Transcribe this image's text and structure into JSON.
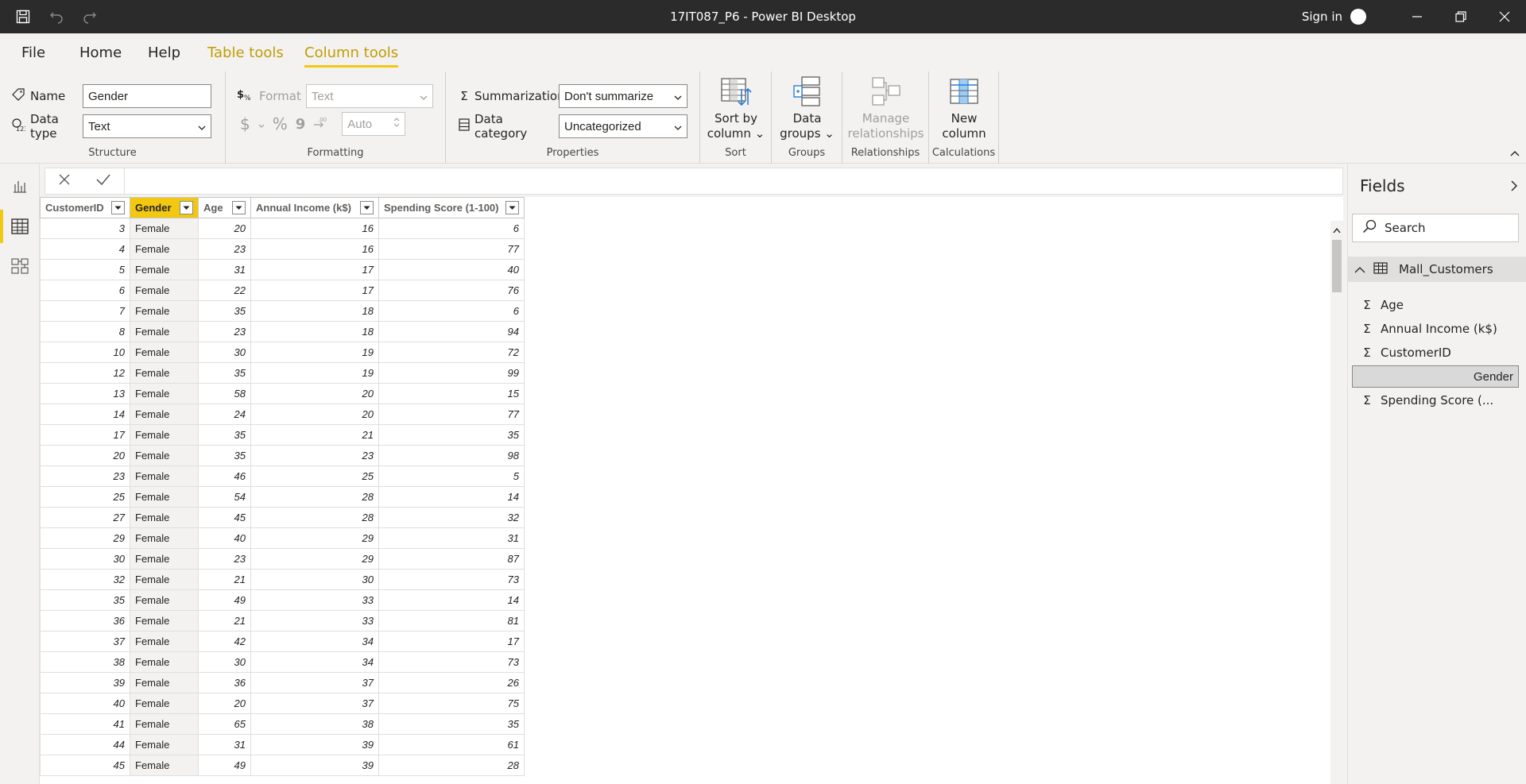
{
  "titlebar": {
    "title": "17IT087_P6 - Power BI Desktop",
    "sign_in": "Sign in"
  },
  "menu": {
    "file": "File",
    "home": "Home",
    "help": "Help",
    "table_tools": "Table tools",
    "column_tools": "Column tools"
  },
  "ribbon": {
    "structure": {
      "name_label": "Name",
      "name_value": "Gender",
      "datatype_label": "Data type",
      "datatype_value": "Text",
      "group_label": "Structure"
    },
    "formatting": {
      "format_label": "Format",
      "format_value": "Text",
      "currency": "$",
      "percent": "%",
      "comma": "9",
      "decimals_value": "Auto",
      "group_label": "Formatting"
    },
    "properties": {
      "summarization_label": "Summarization",
      "summarization_value": "Don't summarize",
      "category_label": "Data category",
      "category_value": "Uncategorized",
      "group_label": "Properties"
    },
    "sort": {
      "btn_line1": "Sort by",
      "btn_line2": "column",
      "group_label": "Sort"
    },
    "groups": {
      "btn_line1": "Data",
      "btn_line2": "groups",
      "group_label": "Groups"
    },
    "relationships": {
      "btn_line1": "Manage",
      "btn_line2": "relationships",
      "group_label": "Relationships"
    },
    "calculations": {
      "btn_line1": "New",
      "btn_line2": "column",
      "group_label": "Calculations"
    }
  },
  "table": {
    "columns": [
      "CustomerID",
      "Gender",
      "Age",
      "Annual Income (k$)",
      "Spending Score (1-100)"
    ],
    "rows": [
      [
        3,
        "Female",
        20,
        16,
        6
      ],
      [
        4,
        "Female",
        23,
        16,
        77
      ],
      [
        5,
        "Female",
        31,
        17,
        40
      ],
      [
        6,
        "Female",
        22,
        17,
        76
      ],
      [
        7,
        "Female",
        35,
        18,
        6
      ],
      [
        8,
        "Female",
        23,
        18,
        94
      ],
      [
        10,
        "Female",
        30,
        19,
        72
      ],
      [
        12,
        "Female",
        35,
        19,
        99
      ],
      [
        13,
        "Female",
        58,
        20,
        15
      ],
      [
        14,
        "Female",
        24,
        20,
        77
      ],
      [
        17,
        "Female",
        35,
        21,
        35
      ],
      [
        20,
        "Female",
        35,
        23,
        98
      ],
      [
        23,
        "Female",
        46,
        25,
        5
      ],
      [
        25,
        "Female",
        54,
        28,
        14
      ],
      [
        27,
        "Female",
        45,
        28,
        32
      ],
      [
        29,
        "Female",
        40,
        29,
        31
      ],
      [
        30,
        "Female",
        23,
        29,
        87
      ],
      [
        32,
        "Female",
        21,
        30,
        73
      ],
      [
        35,
        "Female",
        49,
        33,
        14
      ],
      [
        36,
        "Female",
        21,
        33,
        81
      ],
      [
        37,
        "Female",
        42,
        34,
        17
      ],
      [
        38,
        "Female",
        30,
        34,
        73
      ],
      [
        39,
        "Female",
        36,
        37,
        26
      ],
      [
        40,
        "Female",
        20,
        37,
        75
      ],
      [
        41,
        "Female",
        65,
        38,
        35
      ],
      [
        44,
        "Female",
        31,
        39,
        61
      ],
      [
        45,
        "Female",
        49,
        39,
        28
      ]
    ]
  },
  "fields_pane": {
    "title": "Fields",
    "search_placeholder": "Search",
    "table_name": "Mall_Customers",
    "fields": [
      {
        "name": "Age",
        "sigma": true
      },
      {
        "name": "Annual Income (k$)",
        "sigma": true
      },
      {
        "name": "CustomerID",
        "sigma": true
      },
      {
        "name": "Gender",
        "sigma": false,
        "selected": true
      },
      {
        "name": "Spending Score (...",
        "sigma": true
      }
    ]
  },
  "colors": {
    "accent": "#f2c811",
    "titlebar": "#2b2b2b",
    "contextual_tab": "#c19c00"
  }
}
